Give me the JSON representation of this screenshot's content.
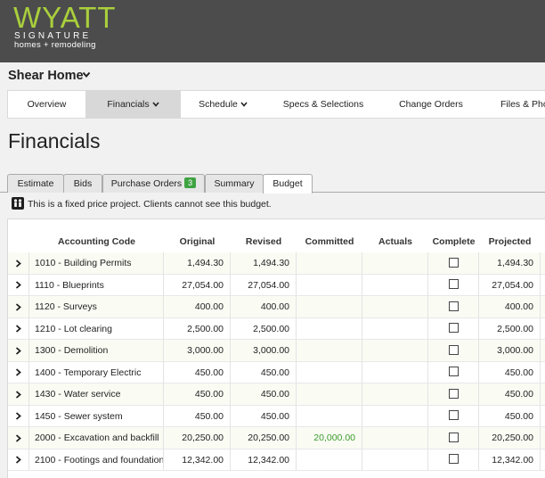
{
  "brand": {
    "name": "WYATT",
    "line1": "SIGNATURE",
    "line2": "homes + remodeling"
  },
  "project": {
    "title": "Shear Home"
  },
  "nav": {
    "overview": "Overview",
    "financials": "Financials",
    "schedule": "Schedule",
    "specs": "Specs & Selections",
    "change_orders": "Change Orders",
    "files": "Files & Pho"
  },
  "page_title": "Financials",
  "tabs": {
    "estimate": "Estimate",
    "bids": "Bids",
    "purchase_orders": "Purchase Orders",
    "purchase_orders_count": "3",
    "summary": "Summary",
    "budget": "Budget"
  },
  "notice": "This is a fixed price project. Clients cannot see this budget.",
  "table": {
    "headers": {
      "code": "Accounting Code",
      "original": "Original",
      "revised": "Revised",
      "committed": "Committed",
      "actuals": "Actuals",
      "complete": "Complete",
      "projected": "Projected"
    },
    "rows": [
      {
        "code": "1010 - Building Permits",
        "original": "1,494.30",
        "revised": "1,494.30",
        "committed": "",
        "actuals": "",
        "projected": "1,494.30"
      },
      {
        "code": "1110 - Blueprints",
        "original": "27,054.00",
        "revised": "27,054.00",
        "committed": "",
        "actuals": "",
        "projected": "27,054.00"
      },
      {
        "code": "1120 - Surveys",
        "original": "400.00",
        "revised": "400.00",
        "committed": "",
        "actuals": "",
        "projected": "400.00"
      },
      {
        "code": "1210 - Lot clearing",
        "original": "2,500.00",
        "revised": "2,500.00",
        "committed": "",
        "actuals": "",
        "projected": "2,500.00"
      },
      {
        "code": "1300 - Demolition",
        "original": "3,000.00",
        "revised": "3,000.00",
        "committed": "",
        "actuals": "",
        "projected": "3,000.00"
      },
      {
        "code": "1400 - Temporary Electric",
        "original": "450.00",
        "revised": "450.00",
        "committed": "",
        "actuals": "",
        "projected": "450.00"
      },
      {
        "code": "1430 - Water service",
        "original": "450.00",
        "revised": "450.00",
        "committed": "",
        "actuals": "",
        "projected": "450.00"
      },
      {
        "code": "1450 - Sewer system",
        "original": "450.00",
        "revised": "450.00",
        "committed": "",
        "actuals": "",
        "projected": "450.00"
      },
      {
        "code": "2000 - Excavation and backfill",
        "original": "20,250.00",
        "revised": "20,250.00",
        "committed": "20,000.00",
        "actuals": "",
        "projected": "20,250.00"
      },
      {
        "code": "2100 - Footings and foundation",
        "original": "12,342.00",
        "revised": "12,342.00",
        "committed": "",
        "actuals": "",
        "projected": "12,342.00"
      }
    ]
  },
  "colors": {
    "brand_green": "#a9cf3c",
    "header_bg": "#4c4c4c",
    "committed_green": "#3b9b2a",
    "badge_green": "#3ea342"
  }
}
